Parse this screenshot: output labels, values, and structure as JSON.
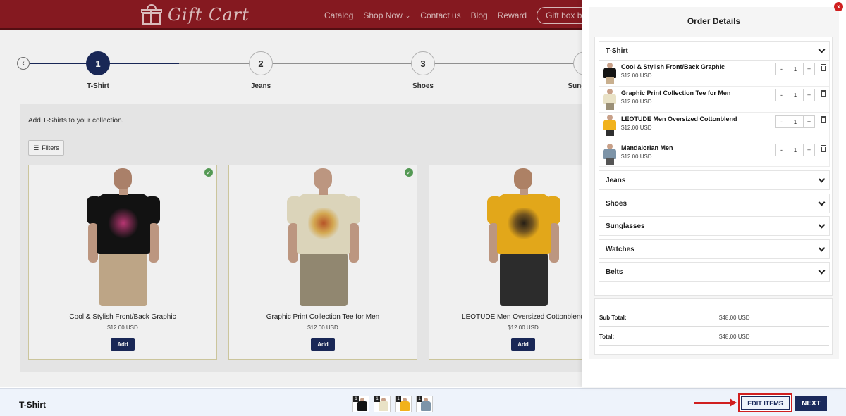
{
  "header": {
    "brand": "Gift Cart",
    "nav": [
      {
        "label": "Catalog"
      },
      {
        "label": "Shop Now",
        "has_dropdown": true
      },
      {
        "label": "Contact us"
      },
      {
        "label": "Blog"
      },
      {
        "label": "Reward"
      }
    ],
    "cta_label": "Gift box builder",
    "colors": {
      "header_bg": "#8e1b22",
      "accent": "#1b2a5c"
    }
  },
  "stepper": {
    "steps": [
      {
        "number": "1",
        "label": "T-Shirt",
        "active": true
      },
      {
        "number": "2",
        "label": "Jeans",
        "active": false
      },
      {
        "number": "3",
        "label": "Shoes",
        "active": false
      },
      {
        "number": "",
        "label": "Sung",
        "active": false
      }
    ]
  },
  "products": {
    "hint": "Add T-Shirts to your collection.",
    "filters_label": "Filters",
    "add_label": "Add",
    "items": [
      {
        "name": "Cool & Stylish Front/Back Graphic",
        "price": "$12.00 USD",
        "selected": true,
        "shirt_color": "#141414"
      },
      {
        "name": "Graphic Print Collection Tee for Men",
        "price": "$12.00 USD",
        "selected": true,
        "shirt_color": "#e9e2c6"
      },
      {
        "name": "LEOTUDE Men Oversized Cottonblend",
        "price": "$12.00 USD",
        "selected": false,
        "shirt_color": "#f1b21c"
      }
    ]
  },
  "bottom_bar": {
    "title": "T-Shirt",
    "thumb_counts": [
      "1",
      "1",
      "1",
      "1"
    ],
    "edit_items_label": "EDIT ITEMS",
    "next_label": "NEXT"
  },
  "drawer": {
    "close_label": "x",
    "title": "Order Details",
    "sections": [
      {
        "label": "T-Shirt",
        "expanded": true
      },
      {
        "label": "Jeans",
        "expanded": false
      },
      {
        "label": "Shoes",
        "expanded": false
      },
      {
        "label": "Sunglasses",
        "expanded": false
      },
      {
        "label": "Watches",
        "expanded": false
      },
      {
        "label": "Belts",
        "expanded": false
      }
    ],
    "order_items": [
      {
        "name": "Cool & Stylish Front/Back Graphic",
        "price": "$12.00 USD",
        "qty": "1",
        "shirt_color": "#141414"
      },
      {
        "name": "Graphic Print Collection Tee for Men",
        "price": "$12.00 USD",
        "qty": "1",
        "shirt_color": "#e9e2c6"
      },
      {
        "name": "LEOTUDE Men Oversized Cottonblend",
        "price": "$12.00 USD",
        "qty": "1",
        "shirt_color": "#f1b21c"
      },
      {
        "name": "Mandalorian Men",
        "price": "$12.00 USD",
        "qty": "1",
        "shirt_color": "#7d94a8"
      }
    ],
    "minus_label": "-",
    "plus_label": "+",
    "subtotal_label": "Sub Total:",
    "subtotal_value": "$48.00 USD",
    "total_label": "Total:",
    "total_value": "$48.00 USD"
  }
}
